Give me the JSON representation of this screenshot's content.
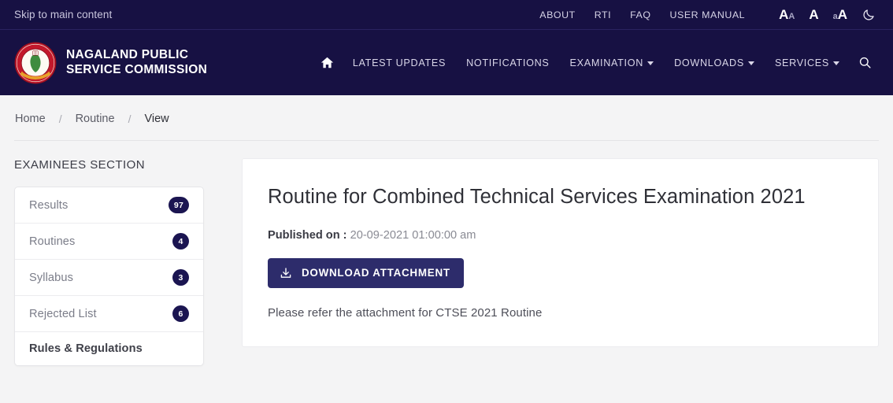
{
  "topbar": {
    "skip_label": "Skip to main content",
    "links": [
      {
        "label": "ABOUT"
      },
      {
        "label": "RTI"
      },
      {
        "label": "FAQ"
      },
      {
        "label": "USER MANUAL"
      }
    ],
    "font_decrease": {
      "big": "A",
      "small": "A"
    },
    "font_normal": "A",
    "font_increase": {
      "small": "a",
      "big": "A"
    },
    "theme_toggle_icon": "moon-icon"
  },
  "header": {
    "logo_icon": "nagaland-psc-seal-icon",
    "brand_line1": "NAGALAND PUBLIC",
    "brand_line2": "SERVICE COMMISSION",
    "nav": [
      {
        "label": "",
        "icon": "home-icon",
        "caret": false
      },
      {
        "label": "LATEST UPDATES",
        "caret": false
      },
      {
        "label": "NOTIFICATIONS",
        "caret": false
      },
      {
        "label": "EXAMINATION",
        "caret": true
      },
      {
        "label": "DOWNLOADS",
        "caret": true
      },
      {
        "label": "SERVICES",
        "caret": true
      }
    ],
    "search_icon": "search-icon"
  },
  "breadcrumb": {
    "items": [
      {
        "label": "Home",
        "current": false
      },
      {
        "label": "Routine",
        "current": false
      },
      {
        "label": "View",
        "current": true
      }
    ],
    "separator": "/"
  },
  "sidebar": {
    "title": "EXAMINEES SECTION",
    "items": [
      {
        "label": "Results",
        "badge": "97",
        "strong": false
      },
      {
        "label": "Routines",
        "badge": "4",
        "strong": false
      },
      {
        "label": "Syllabus",
        "badge": "3",
        "strong": false
      },
      {
        "label": "Rejected List",
        "badge": "6",
        "strong": false
      },
      {
        "label": "Rules & Regulations",
        "badge": "",
        "strong": true
      }
    ]
  },
  "main": {
    "title": "Routine for Combined Technical Services Examination 2021",
    "published_label": "Published on : ",
    "published_value": "20-09-2021 01:00:00 am",
    "download_label": "DOWNLOAD ATTACHMENT",
    "download_icon": "download-icon",
    "description": "Please refer the attachment for CTSE 2021 Routine"
  },
  "colors": {
    "header_navy": "#171143",
    "button_navy": "#2d2c6b",
    "badge_navy": "#1b1551",
    "page_bg": "#f4f4f5",
    "card_white": "#ffffff",
    "seal_red": "#c2182b",
    "seal_green": "#3f8c3f",
    "seal_gold": "#e8a32a"
  }
}
